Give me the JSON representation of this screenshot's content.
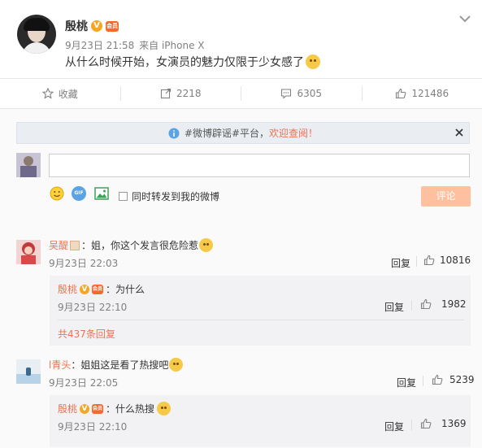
{
  "post": {
    "author": "殷桃",
    "verified_badge": "V",
    "vip_badge": "会员",
    "timestamp": "9月23日 21:58",
    "source": "来自 iPhone X",
    "text": "从什么时候开始，女演员的魅力仅限于少女感了"
  },
  "toolbar": {
    "favorite_label": "收藏",
    "repost_count": "2218",
    "comment_count": "6305",
    "like_count": "121486"
  },
  "notice": {
    "text_prefix": "#微博辟谣#平台，",
    "text_link": "欢迎查阅！"
  },
  "composer": {
    "input_value": "",
    "gif_label": "GIF",
    "repost_checkbox_label": "同时转发到我的微博",
    "submit_label": "评论"
  },
  "comments": [
    {
      "author": "吴醍",
      "text": "：姐，你这个发言很危险惹",
      "time": "9月23日 22:03",
      "reply_label": "回复",
      "likes": "10816",
      "sub_reply": {
        "author": "殷桃",
        "text": "：为什么",
        "time": "9月23日 22:10",
        "reply_label": "回复",
        "likes": "1982"
      },
      "more_replies": "共437条回复"
    },
    {
      "author": "l青头",
      "text": "：姐姐这是看了热搜吧",
      "time": "9月23日 22:05",
      "reply_label": "回复",
      "likes": "5239",
      "sub_reply": {
        "author": "殷桃",
        "text": "：什么热搜",
        "time": "9月23日 22:10",
        "reply_label": "回复",
        "likes": "1369"
      }
    }
  ],
  "colors": {
    "accent": "#eb7350",
    "submit_bg": "#ffc09f",
    "notice_icon": "#5ca3e6"
  },
  "icons": [
    "chevron-down-icon",
    "star-icon",
    "repost-icon",
    "comment-icon",
    "like-icon",
    "info-icon",
    "close-icon",
    "smiley-icon",
    "gif-icon",
    "image-icon",
    "checkbox-icon"
  ]
}
